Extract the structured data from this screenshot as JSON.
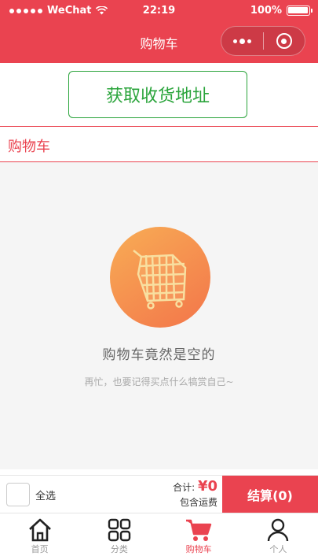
{
  "status_bar": {
    "carrier": "WeChat",
    "time": "22:19",
    "battery": "100%",
    "battery_level": 1.0
  },
  "nav": {
    "title": "购物车"
  },
  "address_button": {
    "label": "获取收货地址"
  },
  "cart": {
    "title": "购物车"
  },
  "empty_state": {
    "title": "购物车竟然是空的",
    "subtitle": "再忙，也要记得买点什么犒赏自己~"
  },
  "checkout": {
    "select_all": "全选",
    "total_label": "合计:",
    "currency": "¥",
    "total_value": "0",
    "shipping_note": "包含运费",
    "pay_label": "结算(0)"
  },
  "tabs": [
    {
      "label": "首页",
      "icon": "home-icon",
      "active": false
    },
    {
      "label": "分类",
      "icon": "category-icon",
      "active": false
    },
    {
      "label": "购物车",
      "icon": "cart-icon",
      "active": true
    },
    {
      "label": "个人",
      "icon": "user-icon",
      "active": false
    }
  ],
  "colors": {
    "accent": "#ea4350",
    "address_green": "#2aa43b",
    "empty_bg": "#f5f5f5"
  }
}
